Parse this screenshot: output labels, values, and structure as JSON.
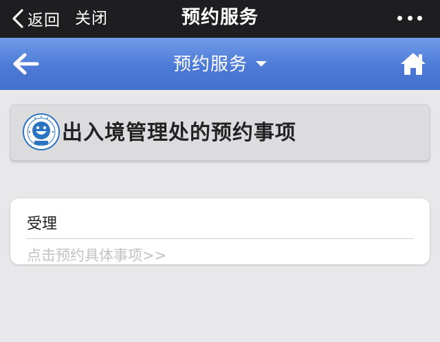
{
  "wechat_bar": {
    "back_label": "返回",
    "close_label": "关闭",
    "title": "预约服务"
  },
  "header": {
    "title": "预约服务",
    "back_icon": "arrow-left-icon",
    "home_icon": "home-icon",
    "dropdown_icon": "caret-down-icon"
  },
  "org": {
    "title": "出入境管理处的预约事项",
    "logo_icon": "smiley-seal-logo"
  },
  "service": {
    "title": "受理",
    "link_text": "点击预约具体事项>>"
  },
  "colors": {
    "wechat_bar": "#1e1e20",
    "header_blue": "#4d7ad6",
    "page_bg": "#e8e8ea",
    "card_gray": "#dcdcdf",
    "link_gray": "#c2c2c4",
    "logo_blue": "#2a73c0"
  }
}
